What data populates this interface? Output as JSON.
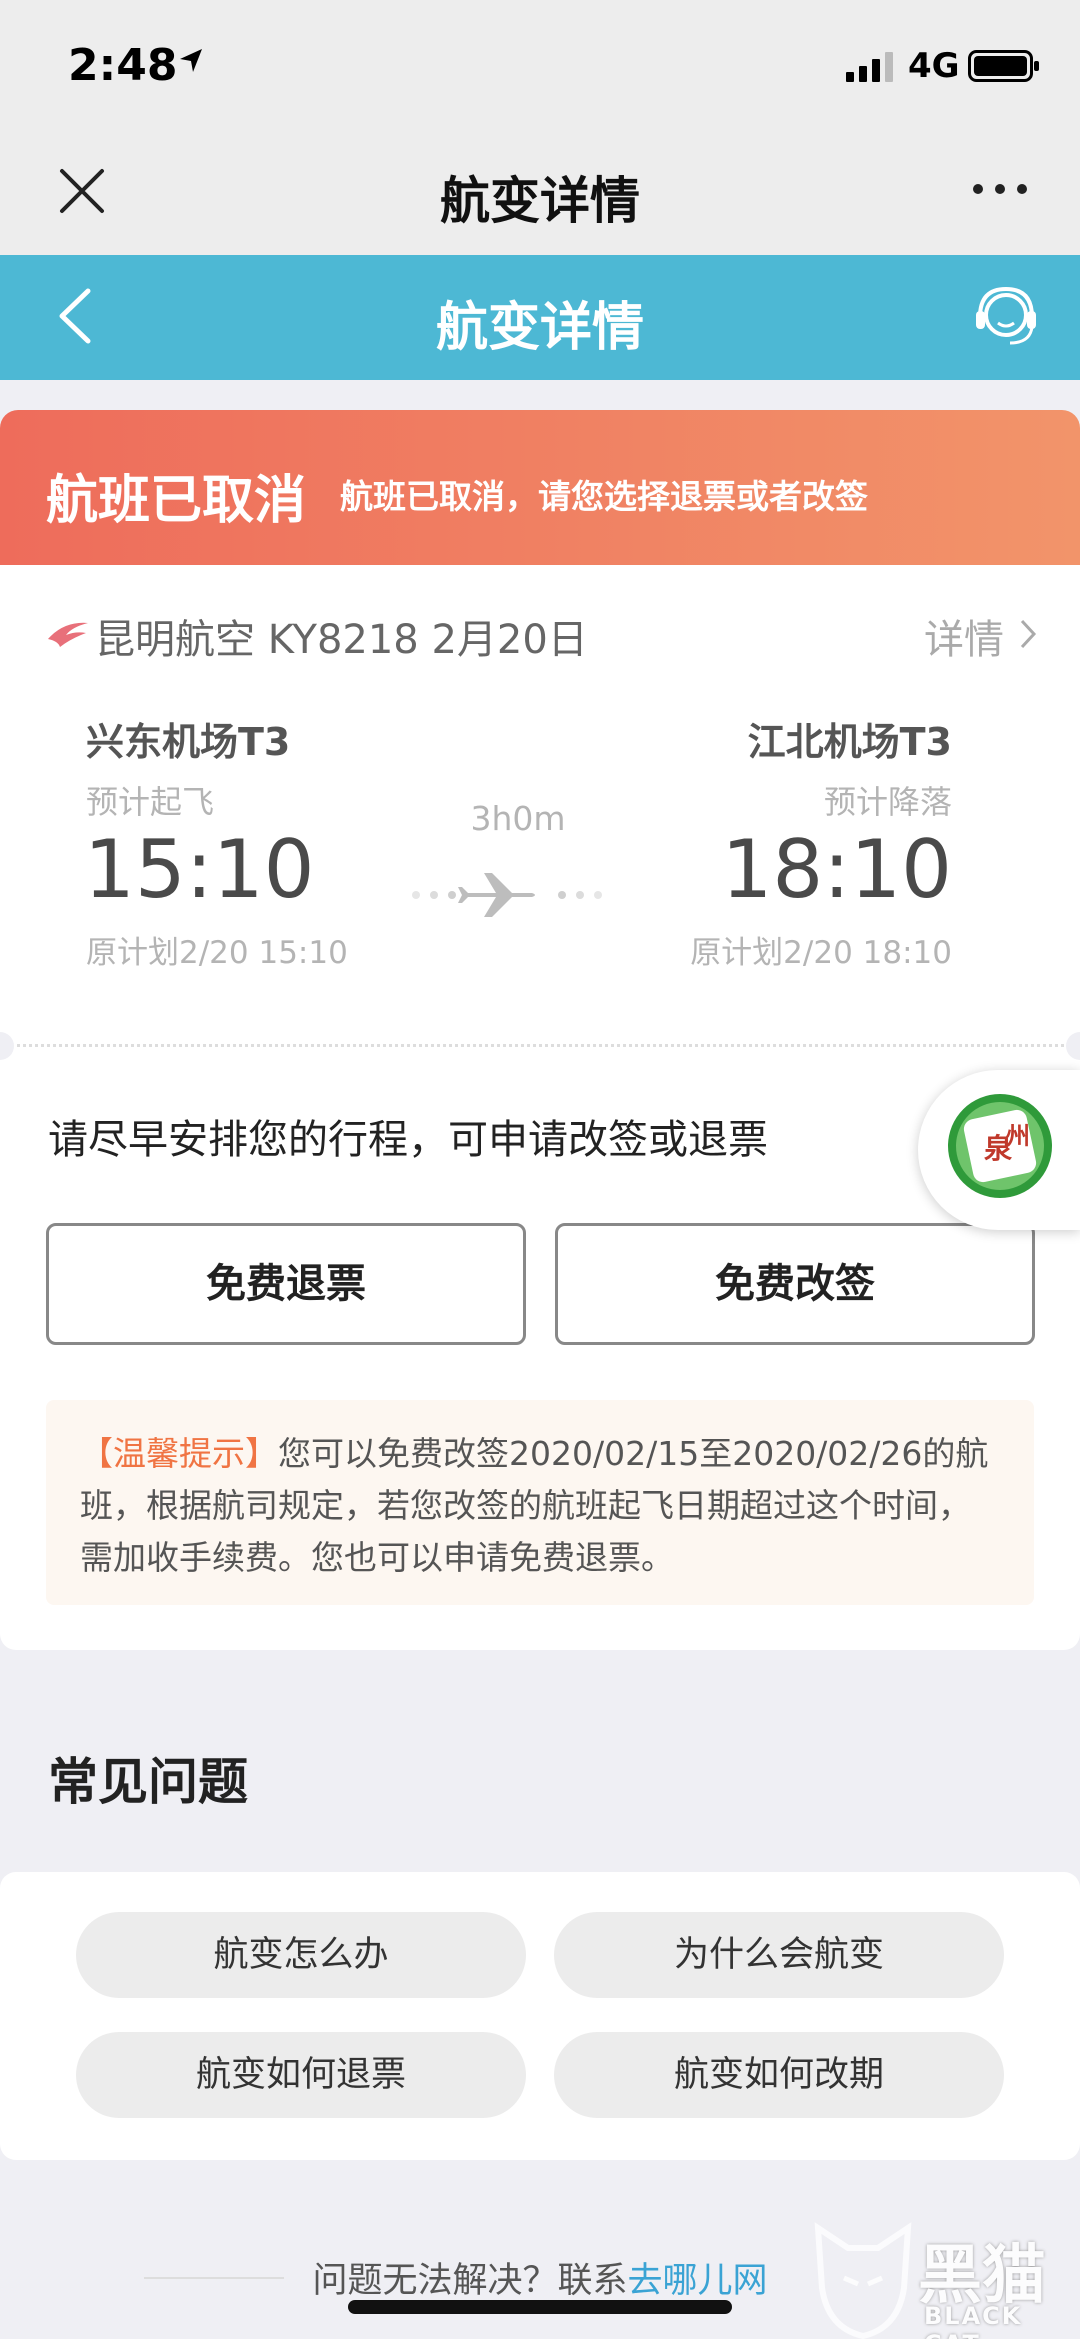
{
  "status_bar": {
    "time": "2:48",
    "network": "4G"
  },
  "wechat_nav": {
    "title": "航变详情"
  },
  "app_header": {
    "title": "航变详情",
    "accent_color": "#4db8d4"
  },
  "banner": {
    "title": "航班已取消",
    "subtitle": "航班已取消，请您选择退票或者改签",
    "colors": [
      "#ee6c5b",
      "#f2946a"
    ]
  },
  "flight": {
    "airline_line": "昆明航空  KY8218   2月20日",
    "detail_link": "详情",
    "duration": "3h0m",
    "departure": {
      "airport": "兴东机场T3",
      "label": "预计起飞",
      "time": "15:10",
      "planned": "原计划2/20 15:10"
    },
    "arrival": {
      "airport": "江北机场T3",
      "label": "预计降落",
      "time": "18:10",
      "planned": "原计划2/20 18:10"
    }
  },
  "action": {
    "prompt": "请尽早安排您的行程，可申请改签或退票",
    "refund_button": "免费退票",
    "change_button": "免费改签",
    "tip_label": "【温馨提示】",
    "tip_text": "您可以免费改签2020/02/15至2020/02/26的航班，根据航司规定，若您改签的航班起飞日期超过这个时间，需加收手续费。您也可以申请免费退票。"
  },
  "mascot": {
    "badge_text": "泉州"
  },
  "faq": {
    "title": "常见问题",
    "items": [
      "航变怎么办",
      "为什么会航变",
      "航变如何退票",
      "航变如何改期"
    ]
  },
  "contact": {
    "prefix": "问题无法解决？联系",
    "link": "去哪儿网"
  },
  "watermark": {
    "text": "黑猫",
    "sub": "BLACK CAT"
  }
}
